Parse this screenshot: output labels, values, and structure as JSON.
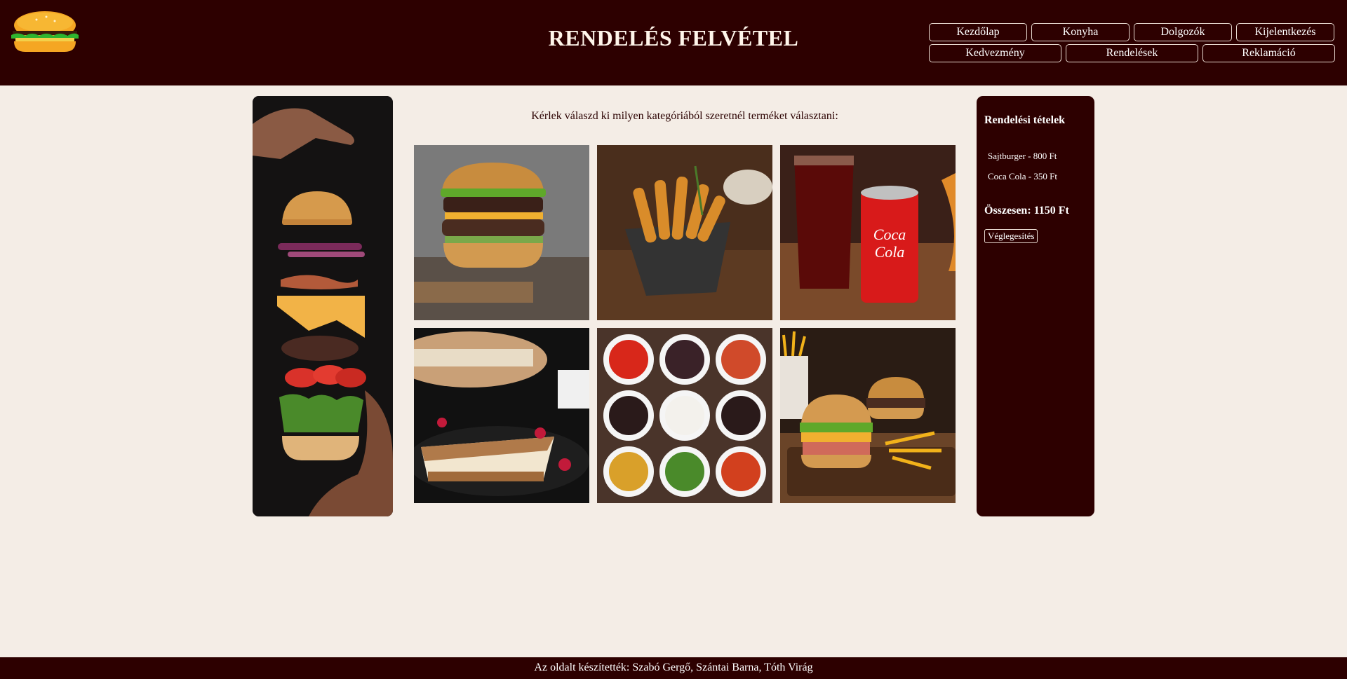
{
  "header": {
    "title": "RENDELÉS FELVÉTEL",
    "logo_icon": "burger-icon"
  },
  "nav": {
    "row1": [
      "Kezdőlap",
      "Konyha",
      "Dolgozók",
      "Kijelentkezés"
    ],
    "row2": [
      "Kedvezmény",
      "Rendelések",
      "Reklamáció"
    ]
  },
  "main": {
    "prompt": "Kérlek válaszd ki milyen kategóriából szeretnél terméket választani:"
  },
  "order": {
    "title": "Rendelési tételek",
    "items": [
      "Sajtburger - 800 Ft",
      "Coca Cola - 350 Ft"
    ],
    "total": "Összesen: 1150 Ft",
    "finalize": "Véglegesítés"
  },
  "footer": {
    "text": "Az oldalt készítették: Szabó Gergő, Szántai Barna, Tóth Virág"
  },
  "colors": {
    "header_bg": "#2d0000",
    "page_bg": "#f4ede6",
    "text": "#2a0000"
  }
}
